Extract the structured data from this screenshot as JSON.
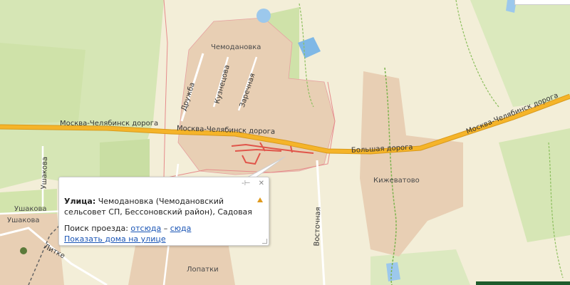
{
  "map_labels": {
    "chemodanovka": "Чемодановка",
    "kuznetsova": "Кузнецова",
    "zarechnaya": "Заречная",
    "druzhba": "Дружба",
    "highway_left": "Москва-Челябинск дорога",
    "highway_center": "Москва-Челябинск дорога",
    "highway_right": "Москва-Челябинск дорога",
    "bolshaya": "Большая дорога",
    "kizhevatovo": "Кижеватово",
    "vostochnaya": "Восточная",
    "lopatki": "Лопатки",
    "ushakova_vertical": "Ушакова",
    "ushakova_1": "Ушакова",
    "ushakova_2": "Ушакова",
    "litke": "Литке"
  },
  "popup": {
    "street_label": "Улица:",
    "street_value": "Чемодановка (Чемодановский сельсовет СП, Бессоновский район), Садовая",
    "route_label": "Поиск проезда:",
    "route_from": "отсюда",
    "route_separator": "–",
    "route_to": "сюда",
    "show_houses": "Показать дома на улице",
    "pin_glyph": "-⊢",
    "close_glyph": "✕"
  },
  "colors": {
    "background": "#f3eed8",
    "settlement": "#e8cfb4",
    "forest": "#d6e6b5",
    "highway": "#f5b429",
    "water": "#9cc8ec",
    "highlight": "#e0554a"
  }
}
